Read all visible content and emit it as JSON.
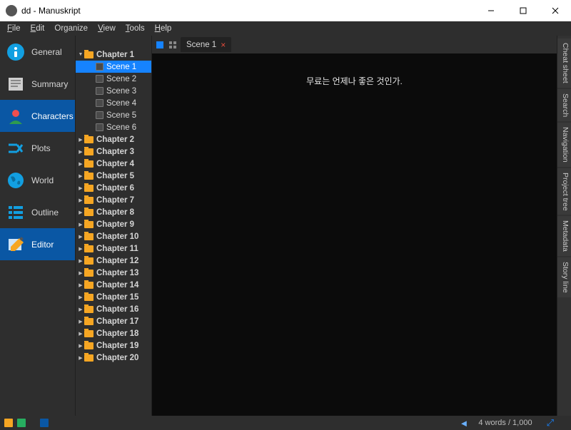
{
  "window": {
    "title": "dd - Manuskript"
  },
  "menu": {
    "items": [
      "File",
      "Edit",
      "Organize",
      "View",
      "Tools",
      "Help"
    ]
  },
  "modes": {
    "items": [
      {
        "id": "general",
        "label": "General"
      },
      {
        "id": "summary",
        "label": "Summary"
      },
      {
        "id": "characters",
        "label": "Characters",
        "selected": false
      },
      {
        "id": "plots",
        "label": "Plots"
      },
      {
        "id": "world",
        "label": "World"
      },
      {
        "id": "outline",
        "label": "Outline"
      },
      {
        "id": "editor",
        "label": "Editor",
        "selected": true
      }
    ]
  },
  "tree": {
    "expanded": {
      "label": "Chapter 1",
      "scenes": [
        "Scene 1",
        "Scene 2",
        "Scene 3",
        "Scene 4",
        "Scene 5",
        "Scene 6"
      ],
      "selected": "Scene 1"
    },
    "collapsed": [
      "Chapter 2",
      "Chapter 3",
      "Chapter 4",
      "Chapter 5",
      "Chapter 6",
      "Chapter 7",
      "Chapter 8",
      "Chapter 9",
      "Chapter 10",
      "Chapter 11",
      "Chapter 12",
      "Chapter 13",
      "Chapter 14",
      "Chapter 15",
      "Chapter 16",
      "Chapter 17",
      "Chapter 18",
      "Chapter 19",
      "Chapter 20"
    ]
  },
  "editor": {
    "tab_label": "Scene 1",
    "content": "무료는 언제나 좋은 것인가."
  },
  "rightdock": {
    "tabs": [
      "Cheat sheet",
      "Search",
      "Navigation",
      "Project tree",
      "Metadata",
      "Story line"
    ]
  },
  "status": {
    "word_count": "4 words / 1,000"
  }
}
